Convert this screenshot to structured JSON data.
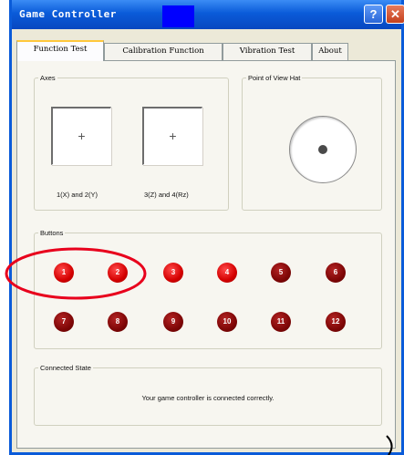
{
  "window": {
    "title": "Game Controller",
    "help_glyph": "?",
    "close_glyph": "✕",
    "accent_color": "#0a5bd9",
    "help_icon": "help-icon",
    "close_icon": "close-icon"
  },
  "tabs": [
    {
      "label": "Function Test",
      "active": true
    },
    {
      "label": "Calibration Function",
      "active": false
    },
    {
      "label": "Vibration Test",
      "active": false
    },
    {
      "label": "About",
      "active": false
    }
  ],
  "axes": {
    "title": "Axes",
    "left_label": "1(X) and 2(Y)",
    "right_label": "3(Z) and 4(Rz)",
    "crosshair": "+"
  },
  "pov": {
    "title": "Point of View Hat"
  },
  "buttons": {
    "title": "Buttons",
    "items": [
      {
        "label": "1",
        "pressed": true
      },
      {
        "label": "2",
        "pressed": true
      },
      {
        "label": "3",
        "pressed": true
      },
      {
        "label": "4",
        "pressed": true
      },
      {
        "label": "5",
        "pressed": false
      },
      {
        "label": "6",
        "pressed": false
      },
      {
        "label": "7",
        "pressed": false
      },
      {
        "label": "8",
        "pressed": false
      },
      {
        "label": "9",
        "pressed": false
      },
      {
        "label": "10",
        "pressed": false
      },
      {
        "label": "11",
        "pressed": false
      },
      {
        "label": "12",
        "pressed": false
      }
    ]
  },
  "connected": {
    "title": "Connected State",
    "status": "Your game controller is connected correctly."
  },
  "annotation": {
    "color": "#e8001c"
  }
}
